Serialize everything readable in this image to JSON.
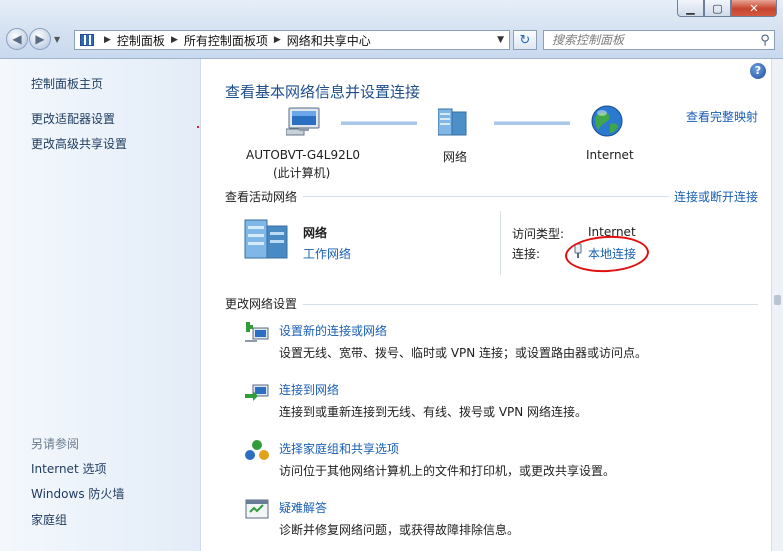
{
  "window": {
    "minimize_glyph": "▁",
    "maximize_glyph": "▢",
    "close_glyph": "✕"
  },
  "address": {
    "crumbs": [
      "控制面板",
      "所有控制面板项",
      "网络和共享中心"
    ],
    "search_placeholder": "搜索控制面板"
  },
  "sidebar": {
    "home": "控制面板主页",
    "links": [
      "更改适配器设置",
      "更改高级共享设置"
    ],
    "see_also_heading": "另请参阅",
    "see_also": [
      "Internet 选项",
      "Windows 防火墙",
      "家庭组"
    ]
  },
  "main": {
    "title": "查看基本网络信息并设置连接",
    "view_full_map": "查看完整映射",
    "map": {
      "computer_name": "AUTOBVT-G4L92L0",
      "computer_sub": "(此计算机)",
      "network": "网络",
      "internet": "Internet"
    },
    "active_heading": "查看活动网络",
    "connect_disconnect": "连接或断开连接",
    "active_network": {
      "name": "网络",
      "type": "工作网络",
      "access_type_label": "访问类型:",
      "access_type_value": "Internet",
      "connection_label": "连接:",
      "connection_value": "本地连接"
    },
    "change_heading": "更改网络设置",
    "tasks": [
      {
        "title": "设置新的连接或网络",
        "desc": "设置无线、宽带、拨号、临时或 VPN 连接；或设置路由器或访问点。",
        "icon": "new-connection-icon"
      },
      {
        "title": "连接到网络",
        "desc": "连接到或重新连接到无线、有线、拨号或 VPN 网络连接。",
        "icon": "connect-network-icon"
      },
      {
        "title": "选择家庭组和共享选项",
        "desc": "访问位于其他网络计算机上的文件和打印机，或更改共享设置。",
        "icon": "homegroup-icon"
      },
      {
        "title": "疑难解答",
        "desc": "诊断并修复网络问题，或获得故障排除信息。",
        "icon": "troubleshoot-icon"
      }
    ]
  },
  "colors": {
    "link": "#1a5fb4",
    "title": "#1e4e8c",
    "annotation": "#e01010"
  }
}
